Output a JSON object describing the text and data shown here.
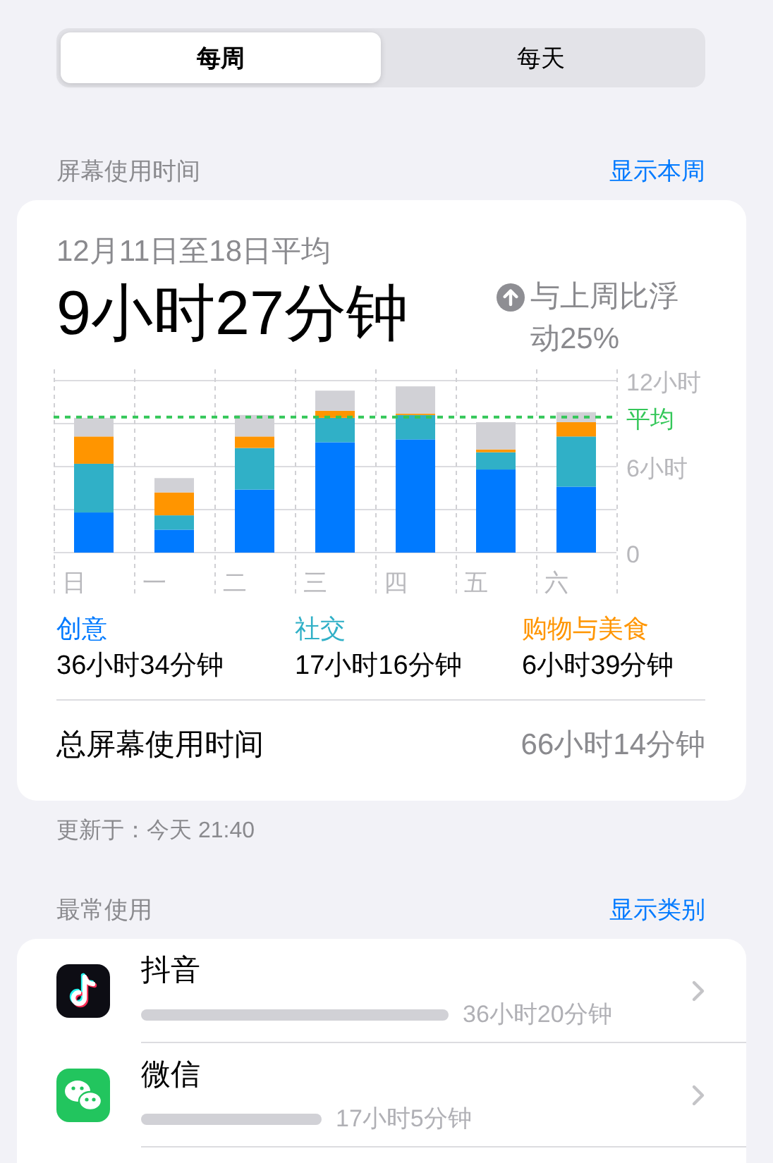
{
  "segments": [
    {
      "label": "每周",
      "selected": true
    },
    {
      "label": "每天",
      "selected": false
    }
  ],
  "screen_time": {
    "header": "屏幕使用时间",
    "link": "显示本周",
    "period": "12月11日至18日平均",
    "average": "9小时27分钟",
    "change": "与上周比浮动25%",
    "chart_data": {
      "type": "bar",
      "stacked": true,
      "categories": [
        "日",
        "一",
        "二",
        "三",
        "四",
        "五",
        "六"
      ],
      "ylim": [
        0,
        12
      ],
      "yticks": [
        {
          "value": 0,
          "label": "0"
        },
        {
          "value": 6,
          "label": "6小时"
        },
        {
          "value": 12,
          "label": "12小时"
        }
      ],
      "series": [
        {
          "name": "创意",
          "color": "#007aff",
          "values": [
            2.8,
            1.6,
            4.4,
            7.7,
            7.9,
            5.8,
            4.6
          ]
        },
        {
          "name": "社交",
          "color": "#30b0c7",
          "values": [
            3.4,
            1.0,
            2.9,
            1.7,
            1.7,
            1.2,
            3.5
          ]
        },
        {
          "name": "购物与美食",
          "color": "#ff9500",
          "values": [
            1.9,
            1.6,
            0.8,
            0.5,
            0.1,
            0.2,
            1.0
          ]
        },
        {
          "color": "#d1d1d6",
          "values": [
            1.3,
            1.0,
            1.5,
            1.4,
            1.9,
            1.9,
            0.7
          ]
        }
      ],
      "ref_lines": [
        {
          "axis": "y",
          "value": 9.45,
          "label": "平均",
          "color": "#34c759"
        }
      ]
    },
    "legend_values": [
      "36小时34分钟",
      "17小时16分钟",
      "6小时39分钟"
    ],
    "total_label": "总屏幕使用时间",
    "total_value": "66小时14分钟"
  },
  "updated": "更新于：今天 21:40",
  "most_used": {
    "header": "最常使用",
    "link": "显示类别",
    "apps": [
      {
        "name": "抖音",
        "kind": "video",
        "time": "36小时20分钟"
      },
      {
        "name": "微信",
        "kind": "chat",
        "time": "17小时5分钟"
      }
    ]
  }
}
